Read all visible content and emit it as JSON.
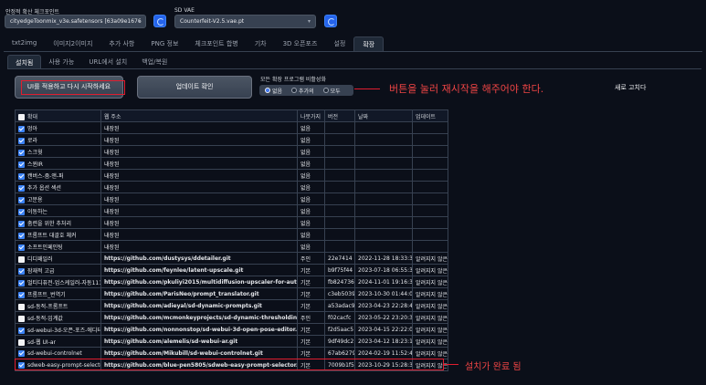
{
  "header": {
    "checkpoint_label": "안정적 확산 체크포인트",
    "checkpoint_value": "cityedgeToonmix_v3e.safetensors [63a09e1676",
    "vae_label": "SD VAE",
    "vae_value": "Counterfeit-V2.5.vae.pt"
  },
  "tabs": [
    "txt2img",
    "이미지2이미지",
    "추가 사항",
    "PNG 정보",
    "체크포인트 합병",
    "기차",
    "3D 오픈포즈",
    "설정",
    "확장"
  ],
  "subtabs": [
    "설치됨",
    "사용 가능",
    "URL에서 설치",
    "백업/복원"
  ],
  "buttons": {
    "apply": "UI를 적용하고 다시 시작하세요",
    "check": "업데이트 확인"
  },
  "disable": {
    "label": "모든 확장 프로그램 비활성화",
    "options": [
      "없음",
      "추가의",
      "모두"
    ]
  },
  "refresh_note": "새로 고치다",
  "annotations": {
    "restart": "버튼을 눌러 재시작을 해주어야 한다.",
    "done": "설치가 완료 됨"
  },
  "table": {
    "headers": [
      "확대",
      "웹 주소",
      "나뭇가지",
      "버전",
      "날짜",
      "업데이트"
    ],
    "rows": [
      {
        "name": "멍아",
        "url": "내장된",
        "branch": "없음",
        "version": "",
        "date": "",
        "update": "",
        "checked": true
      },
      {
        "name": "로라",
        "url": "내장된",
        "branch": "없음",
        "version": "",
        "date": "",
        "update": "",
        "checked": true
      },
      {
        "name": "스크윗",
        "url": "내장된",
        "branch": "없음",
        "version": "",
        "date": "",
        "update": "",
        "checked": true
      },
      {
        "name": "스윈IR",
        "url": "내장된",
        "branch": "없음",
        "version": "",
        "date": "",
        "update": "",
        "checked": true
      },
      {
        "name": "캔버스-줌-앤-퍼",
        "url": "내장된",
        "branch": "없음",
        "version": "",
        "date": "",
        "update": "",
        "checked": true
      },
      {
        "name": "추가 옵션 섹션",
        "url": "내장된",
        "branch": "없음",
        "version": "",
        "date": "",
        "update": "",
        "checked": true
      },
      {
        "name": "고분용",
        "url": "내장된",
        "branch": "없음",
        "version": "",
        "date": "",
        "update": "",
        "checked": true
      },
      {
        "name": "이동하는",
        "url": "내장된",
        "branch": "없음",
        "version": "",
        "date": "",
        "update": "",
        "checked": true
      },
      {
        "name": "춤련을 위한 추처리",
        "url": "내장된",
        "branch": "없음",
        "version": "",
        "date": "",
        "update": "",
        "checked": true
      },
      {
        "name": "프롬프트 대괄호 체커",
        "url": "내장된",
        "branch": "없음",
        "version": "",
        "date": "",
        "update": "",
        "checked": true
      },
      {
        "name": "소프트인페인팅",
        "url": "내장된",
        "branch": "없음",
        "version": "",
        "date": "",
        "update": "",
        "checked": true
      },
      {
        "name": "디디패일러",
        "url": "https://github.com/dustysys/ddetailer.git",
        "branch": "주인",
        "version": "22e7414",
        "date": "2022-11-28 18:33:31",
        "update": "알려지지 않은",
        "checked": false
      },
      {
        "name": "잠재적 고급",
        "url": "https://github.com/feynlee/latent-upscale.git",
        "branch": "기본",
        "version": "b9f75f44",
        "date": "2023-07-18 06:55:32",
        "update": "알려지지 않은",
        "checked": true
      },
      {
        "name": "멀티디퓨전-업스케일러-자동1111",
        "url": "https://github.com/pkuliyi2015/multidiffusion-upscaler-for-automatic1111.git",
        "branch": "기본",
        "version": "fb824736",
        "date": "2024-11-01 19:16:31",
        "update": "알려지지 않은",
        "checked": true
      },
      {
        "name": "프롬프트_번역기",
        "url": "https://github.com/ParisNeo/prompt_translator.git",
        "branch": "기본",
        "version": "c3eb5039",
        "date": "2023-10-30 01:44:08",
        "update": "알려지지 않은",
        "checked": true
      },
      {
        "name": "sd-동적-프롬프트",
        "url": "https://github.com/adieyal/sd-dynamic-prompts.git",
        "branch": "기본",
        "version": "a53adac9",
        "date": "2023-04-23 22:28:49",
        "update": "알려지지 않은",
        "checked": false
      },
      {
        "name": "sd-동적-임계값",
        "url": "https://github.com/mcmonkeyprojects/sd-dynamic-thresholding.git",
        "branch": "주인",
        "version": "f02cacfc",
        "date": "2023-05-22 23:20:30",
        "update": "알려지지 않은",
        "checked": false
      },
      {
        "name": "sd-webui-3d-오픈-포즈-에디터",
        "url": "https://github.com/nonnonstop/sd-webui-3d-open-pose-editor.git",
        "branch": "기본",
        "version": "f2d5aac5",
        "date": "2023-04-15 22:22:06",
        "update": "알려지지 않은",
        "checked": true
      },
      {
        "name": "sd-웹 UI-ar",
        "url": "https://github.com/alemelis/sd-webui-ar.git",
        "branch": "기본",
        "version": "9df49dc2",
        "date": "2023-04-12 18:23:17",
        "update": "알려지지 않은",
        "checked": false
      },
      {
        "name": "sd-webui-controlnet",
        "url": "https://github.com/Mikubill/sd-webui-controlnet.git",
        "branch": "기본",
        "version": "67ab6279",
        "date": "2024-02-19 11:52:46",
        "update": "알려지지 않은",
        "checked": true
      },
      {
        "name": "sdweb-easy-prompt-selector",
        "url": "https://github.com/blue-pen5805/sdweb-easy-prompt-selector.git",
        "branch": "기본",
        "version": "7009b1f5",
        "date": "2023-10-29 15:28:38",
        "update": "알려지지 않은",
        "checked": true
      }
    ]
  }
}
